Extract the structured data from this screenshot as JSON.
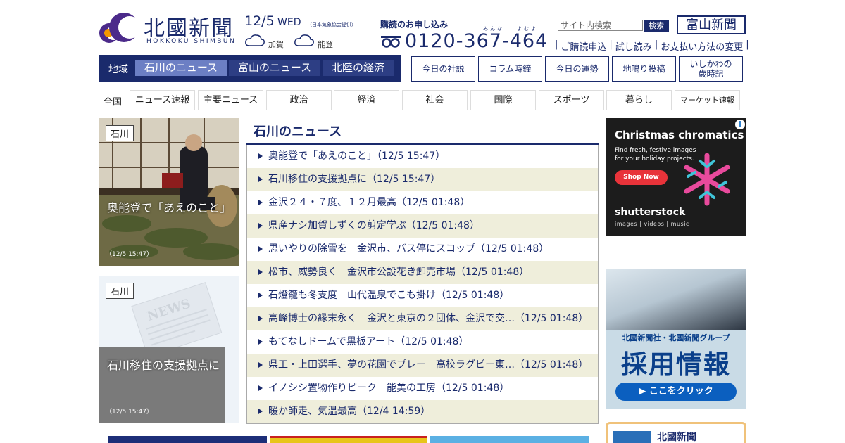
{
  "header": {
    "logo_title": "北國新聞",
    "logo_subtitle": "HOKKOKU SHIMBUN",
    "date": "12/5",
    "weekday": "WED",
    "weather_credit": "（日本気象協会提供）",
    "weather": [
      {
        "area": "加賀",
        "icon": "cloud-icon"
      },
      {
        "area": "能登",
        "icon": "cloud-icon"
      }
    ],
    "subscribe_label": "購読のお申し込み",
    "ruby_mina": "みんな",
    "ruby_yomu": "よむよ",
    "phone": "0120-367-464",
    "search_placeholder": "サイト内検索",
    "search_button": "検索",
    "toyama_link": "富山新聞",
    "util_links": [
      "ご購読申込",
      "試し読み",
      "お支払い方法の変更"
    ]
  },
  "region_nav": {
    "label": "地域",
    "tabs": [
      "石川のニュース",
      "富山のニュース",
      "北陸の経済"
    ]
  },
  "column_buttons": [
    "今日の社説",
    "コラム時鐘",
    "今日の運勢",
    "地鳴り投稿",
    "いしかわの\n歳時記"
  ],
  "category_nav": {
    "label": "全国",
    "items": [
      "ニュース速報",
      "主要ニュース",
      "政治",
      "経済",
      "社会",
      "国際",
      "スポーツ",
      "暮らし",
      "マーケット速報"
    ]
  },
  "features": [
    {
      "tag": "石川",
      "title": "奥能登で「あえのこと」",
      "time": "（12/5 15:47）"
    },
    {
      "tag": "石川",
      "title": "石川移住の支援拠点に",
      "time": "（12/5 15:47）",
      "watermark": "NEWS"
    }
  ],
  "news": {
    "heading": "石川のニュース",
    "items": [
      "奥能登で「あえのこと」（12/5 15:47）",
      "石川移住の支援拠点に（12/5 15:47）",
      "金沢２４・７度、１２月最高（12/5 01:48）",
      "県産ナシ加賀しずくの剪定学ぶ（12/5 01:48）",
      "思いやりの除雪を　金沢市、バス停にスコップ（12/5 01:48）",
      "松市、威勢良く　金沢市公設花き卸売市場（12/5 01:48）",
      "石燈籠も冬支度　山代温泉でこも掛け（12/5 01:48）",
      "高峰博士の縁末永く　金沢と東京の２団体、金沢で交…（12/5 01:48）",
      "もてなしドームで黒板アート（12/5 01:48）",
      "県工・上田選手、夢の花園でプレー　高校ラグビー東…（12/5 01:48）",
      "イノシシ置物作りピーク　能美の工房（12/5 01:48）",
      "暖か師走、気温最高（12/4 14:59）"
    ]
  },
  "ads": {
    "shutterstock": {
      "headline": "Christmas chromatics",
      "sub": "Find fresh, festive images for your holiday projects.",
      "button": "Shop Now",
      "brand": "shutterstock",
      "brand_sub": "images  |  videos  |  music",
      "info": "i"
    },
    "recruit": {
      "sub": "北國新聞社・北國新聞グループ",
      "title": "採用情報",
      "button": "▶ ここをクリック"
    },
    "hokkoku_box_title": "北國新聞"
  },
  "colors": {
    "brand_navy": "#1a2a6c",
    "active_tab": "#6c7fc4",
    "list_stripe": "#efeedb",
    "logo_orange": "#f39800",
    "logo_purple": "#4b2a8a"
  }
}
